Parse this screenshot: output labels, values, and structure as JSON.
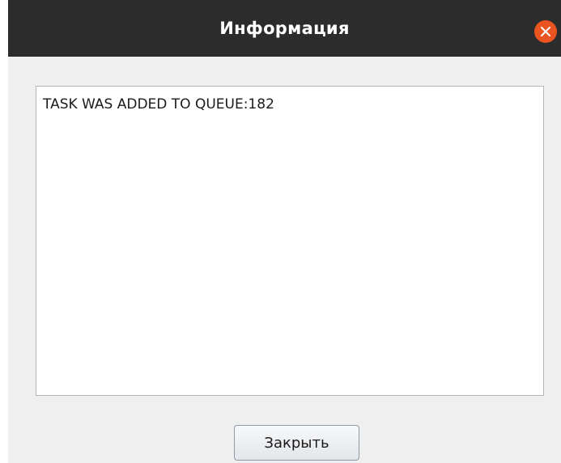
{
  "window": {
    "title": "Информация"
  },
  "content": {
    "message": "TASK WAS ADDED TO QUEUE:182"
  },
  "actions": {
    "close_label": "Закрыть"
  },
  "colors": {
    "titlebar": "#2c2c2c",
    "close_accent": "#e95420"
  },
  "icons": {
    "titlebar_close": "close-icon"
  }
}
